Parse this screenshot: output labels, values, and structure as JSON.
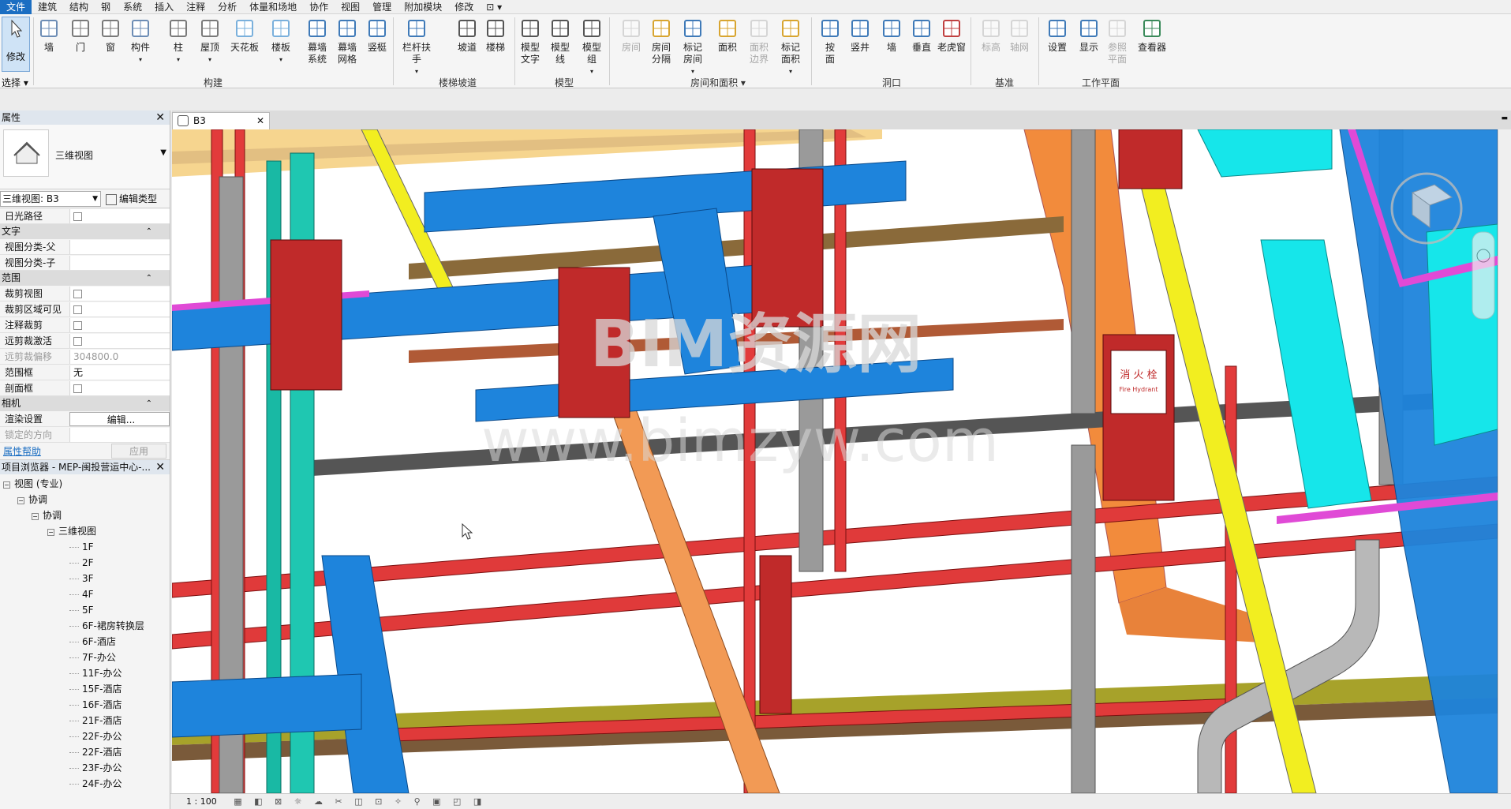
{
  "menubar": {
    "items": [
      "文件",
      "建筑",
      "结构",
      "钢",
      "系统",
      "插入",
      "注释",
      "分析",
      "体量和场地",
      "协作",
      "视图",
      "管理",
      "附加模块",
      "修改"
    ]
  },
  "ribbon": {
    "modify": "修改",
    "select_label": "选择",
    "groups": {
      "build": "构建",
      "stairs": "楼梯坡道",
      "model": "模型",
      "room_area": "房间和面积",
      "opening": "洞口",
      "datum": "基准",
      "workplane": "工作平面"
    },
    "tools": {
      "wall": "墙",
      "door": "门",
      "window": "窗",
      "component": "构件",
      "column": "柱",
      "roof": "屋顶",
      "ceiling": "天花板",
      "floor": "楼板",
      "curtain_system_1": "幕墙",
      "curtain_system_2": "系统",
      "curtain_grid_1": "幕墙",
      "curtain_grid_2": "网格",
      "mullion": "竖梃",
      "railing": "栏杆扶手",
      "ramp": "坡道",
      "stair": "楼梯",
      "model_text_1": "模型",
      "model_text_2": "文字",
      "model_line_1": "模型",
      "model_line_2": "线",
      "model_group_1": "模型",
      "model_group_2": "组",
      "room": "房间",
      "room_sep_1": "房间",
      "room_sep_2": "分隔",
      "tag_room_1": "标记",
      "tag_room_2": "房间",
      "area": "面积",
      "area_boundary_1": "面积",
      "area_boundary_2": "边界",
      "tag_area_1": "标记",
      "tag_area_2": "面积",
      "by_face_1": "按",
      "by_face_2": "面",
      "shaft": "竖井",
      "opening_wall": "墙",
      "vertical": "垂直",
      "dormer": "老虎窗",
      "level": "标高",
      "grid": "轴网",
      "set": "设置",
      "show": "显示",
      "ref_plane_1": "参照",
      "ref_plane_2": "平面",
      "viewer": "查看器"
    }
  },
  "properties": {
    "title": "属性",
    "type_name": "三维视图",
    "view_selector": "三维视图: B3",
    "edit_type": "编辑类型",
    "rows_top": [
      {
        "k": "日光路径",
        "checkbox": true
      }
    ],
    "cat_text": "文字",
    "rows_text": [
      {
        "k": "视图分类-父",
        "v": ""
      },
      {
        "k": "视图分类-子",
        "v": ""
      }
    ],
    "cat_extents": "范围",
    "rows_extents": [
      {
        "k": "裁剪视图",
        "checkbox": true
      },
      {
        "k": "裁剪区域可见",
        "checkbox": true
      },
      {
        "k": "注释裁剪",
        "checkbox": true
      },
      {
        "k": "远剪裁激活",
        "checkbox": true
      },
      {
        "k": "远剪裁偏移",
        "v": "304800.0",
        "dim": true
      },
      {
        "k": "范围框",
        "v": "无"
      },
      {
        "k": "剖面框",
        "checkbox": true
      }
    ],
    "cat_camera": "相机",
    "rows_camera": [
      {
        "k": "渲染设置",
        "v": "编辑..."
      },
      {
        "k": "锁定的方向",
        "v": "",
        "dim": true
      }
    ],
    "help": "属性帮助",
    "apply": "应用"
  },
  "browser": {
    "title": "项目浏览器 - MEP-闽投营运中心-...",
    "root": "视图 (专业)",
    "level1": "协调",
    "level2": "协调",
    "level3": "三维视图",
    "views": [
      "1F",
      "2F",
      "3F",
      "4F",
      "5F",
      "6F-裙房转换层",
      "6F-酒店",
      "7F-办公",
      "11F-办公",
      "15F-酒店",
      "16F-酒店",
      "21F-酒店",
      "22F-办公",
      "22F-酒店",
      "23F-办公",
      "24F-办公"
    ]
  },
  "viewport": {
    "tab": "B3",
    "watermark_1": "BIM资源网",
    "watermark_2": "www.bimzyw.com",
    "fire_label": "消 火 栓",
    "fire_sub": "Fire Hydrant"
  },
  "status": {
    "scale": "1 : 100"
  },
  "colors": {
    "accent": "#1b6ec2",
    "duct_blue": "#1e7fd6",
    "pipe_red": "#d93030",
    "cyan": "#16e6ea",
    "orange": "#f08a3a"
  }
}
